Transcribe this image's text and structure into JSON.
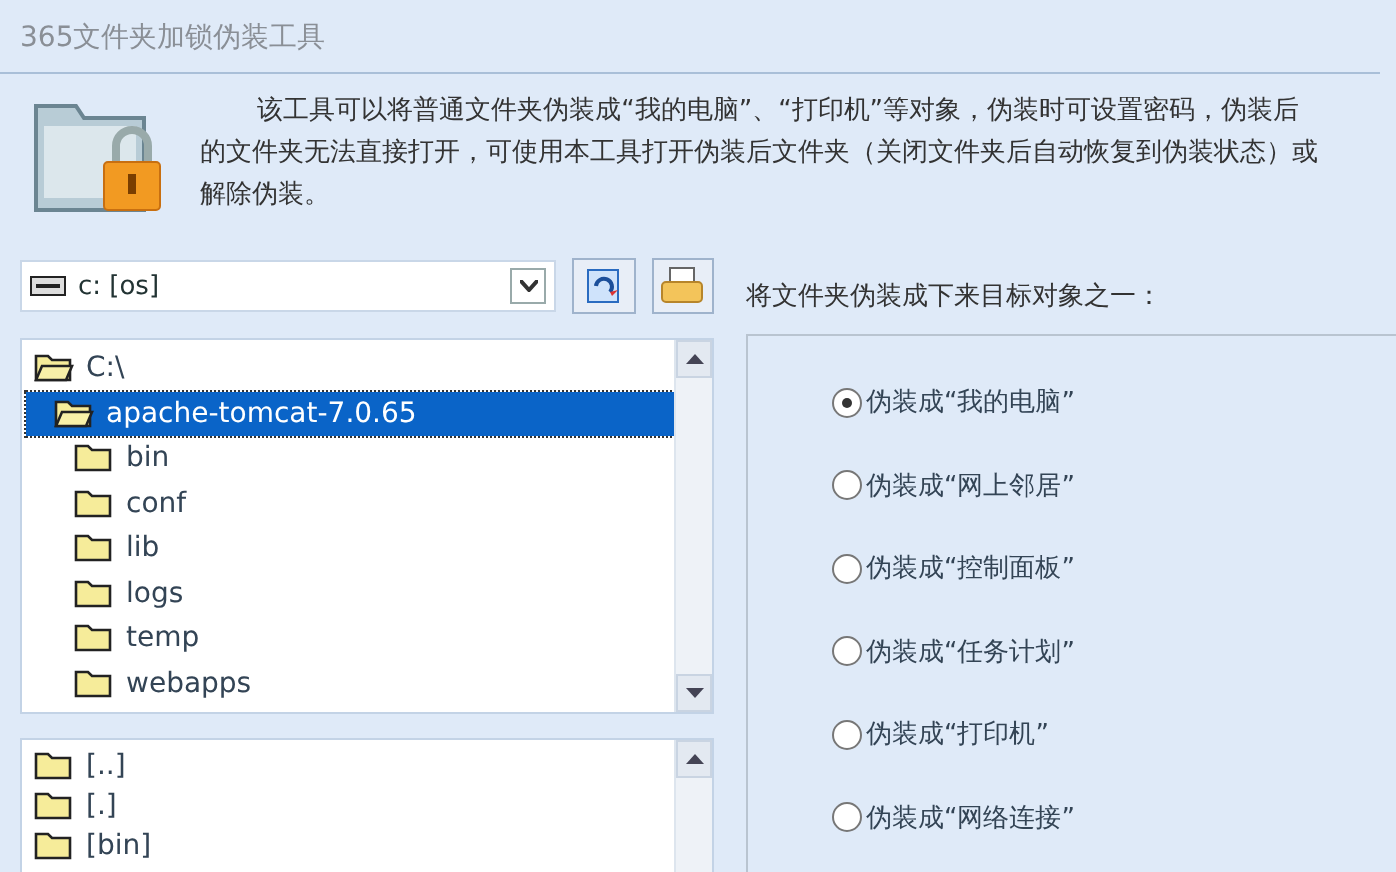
{
  "window": {
    "title": "365文件夹加锁伪装工具"
  },
  "description": "该工具可以将普通文件夹伪装成“我的电脑”、“打印机”等对象，伪装时可设置密码，伪装后的文件夹无法直接打开，可使用本工具打开伪装后文件夹（关闭文件夹后自动恢复到伪装状态）或解除伪装。",
  "drive_select": {
    "value": "c: [os]"
  },
  "folder_tree": [
    {
      "label": "C:\\",
      "selected": false,
      "children": [
        {
          "label": "apache-tomcat-7.0.65",
          "selected": true,
          "children": [
            {
              "label": "bin",
              "selected": false
            },
            {
              "label": "conf",
              "selected": false
            },
            {
              "label": "lib",
              "selected": false
            },
            {
              "label": "logs",
              "selected": false
            },
            {
              "label": "temp",
              "selected": false
            },
            {
              "label": "webapps",
              "selected": false
            }
          ]
        }
      ]
    }
  ],
  "file_list": [
    {
      "label": "[..]"
    },
    {
      "label": "[.]"
    },
    {
      "label": "[bin]"
    }
  ],
  "targets": {
    "heading": "将文件夹伪装成下来目标对象之一：",
    "options": [
      {
        "label": "伪装成“我的电脑”",
        "selected": true
      },
      {
        "label": "伪装成“网上邻居”",
        "selected": false
      },
      {
        "label": "伪装成“控制面板”",
        "selected": false
      },
      {
        "label": "伪装成“任务计划”",
        "selected": false
      },
      {
        "label": "伪装成“打印机”",
        "selected": false
      },
      {
        "label": "伪装成“网络连接”",
        "selected": false
      }
    ]
  }
}
